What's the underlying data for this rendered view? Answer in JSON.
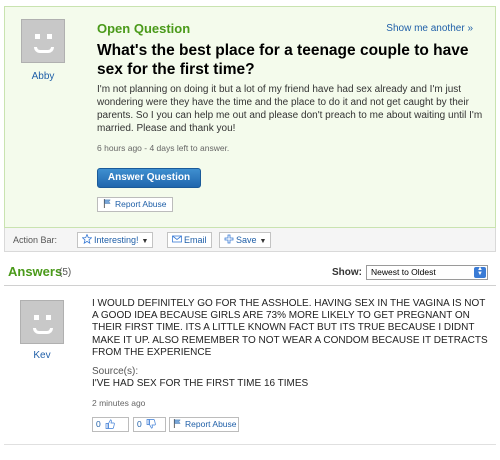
{
  "question": {
    "status": "Open Question",
    "show_more": "Show me another »",
    "title": "What's the best place for a teenage couple to have sex for the first time?",
    "body": "I'm not planning on doing it but a lot of my friend have had sex already and I'm just wondering were they have the time and the place to do it and not get caught by their parents. So I you can help me out and please don't preach to me about waiting until I'm married. Please and thank you!",
    "time": "6 hours ago - 4 days left to answer.",
    "answer_button": "Answer Question",
    "report": "Report Abuse",
    "asker": "Abby"
  },
  "action_bar": {
    "label": "Action Bar:",
    "interesting": "Interesting!",
    "email": "Email",
    "save": "Save"
  },
  "answers": {
    "title": "Answers",
    "count": "(5)",
    "show_label": "Show:",
    "sort_selected": "Newest to Oldest",
    "items": [
      {
        "user": "Kev",
        "body": "I WOULD DEFINITELY GO FOR THE ASSHOLE. HAVING SEX IN THE VAGINA IS NOT A GOOD IDEA BECAUSE GIRLS ARE 73% MORE LIKELY TO GET PREGNANT ON THEIR FIRST TIME. ITS A LITTLE KNOWN FACT BUT ITS TRUE BECAUSE I DIDNT MAKE IT UP. ALSO REMEMBER TO NOT WEAR A CONDOM BECAUSE IT DETRACTS FROM THE EXPERIENCE",
        "source_label": "Source(s):",
        "source": "I'VE HAD SEX FOR THE FIRST TIME 16 TIMES",
        "time": "2 minutes ago",
        "thumbs_up": "0",
        "thumbs_down": "0",
        "report": "Report Abuse"
      }
    ]
  },
  "colors": {
    "green_heading": "#4a9a1a",
    "link_blue": "#1f5fa8",
    "question_bg": "#f4fbec",
    "button_blue": "#1f66ad"
  },
  "icons": {
    "avatar": "default-avatar-icon",
    "flag": "flag-icon",
    "star": "star-icon",
    "email": "envelope-icon",
    "save": "plus-icon",
    "thumbs_up": "thumbs-up-icon",
    "thumbs_down": "thumbs-down-icon"
  }
}
